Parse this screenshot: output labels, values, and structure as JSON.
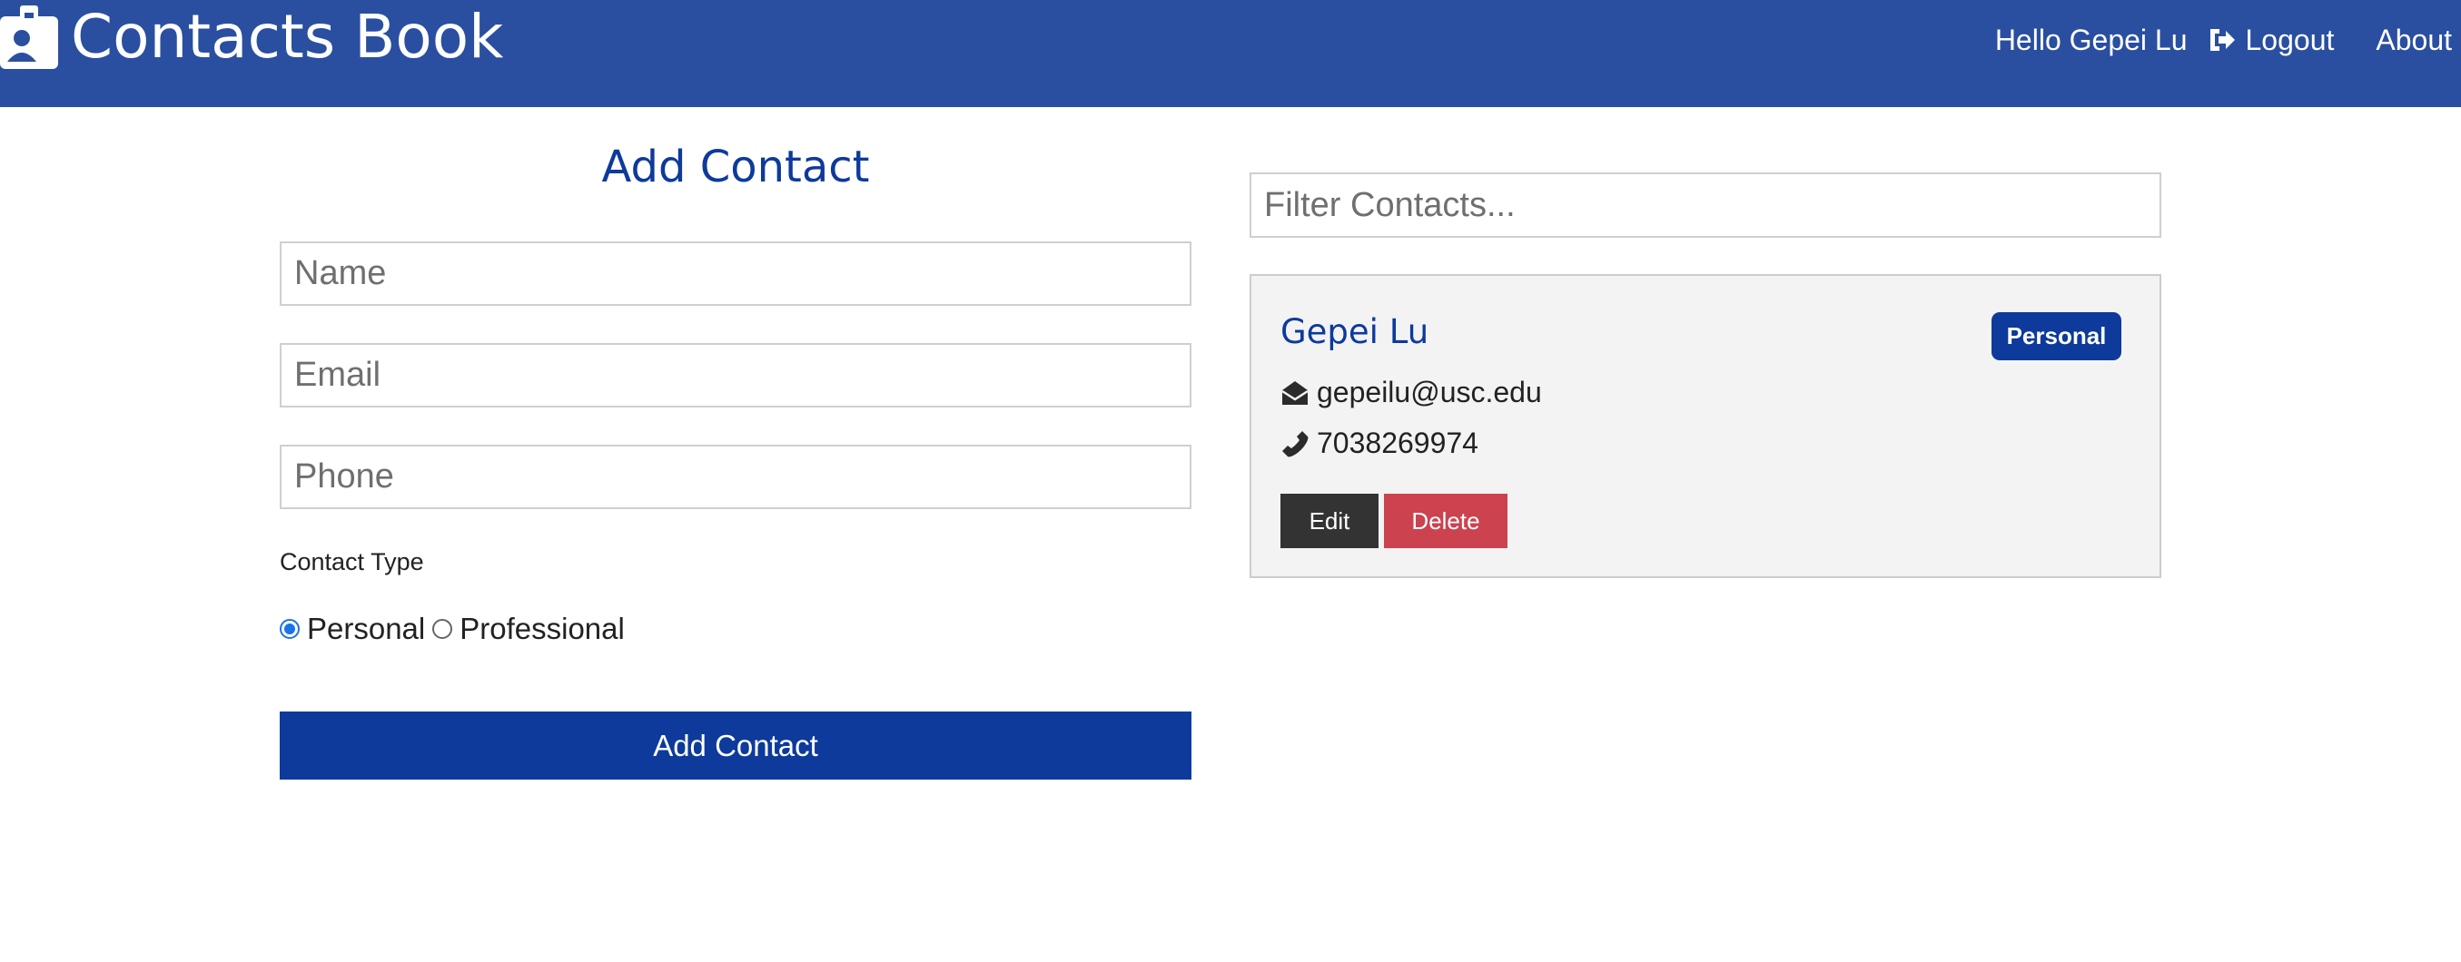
{
  "navbar": {
    "brand_icon": "contact-card-icon",
    "title": "Contacts Book",
    "greeting": "Hello Gepei Lu",
    "logout_icon": "sign-out-icon",
    "logout_label": "Logout",
    "about_label": "About",
    "background_color": "#2a4fa0"
  },
  "form": {
    "heading": "Add Contact",
    "name_placeholder": "Name",
    "email_placeholder": "Email",
    "phone_placeholder": "Phone",
    "type_label": "Contact Type",
    "options": [
      {
        "label": "Personal",
        "checked": true
      },
      {
        "label": "Professional",
        "checked": false
      }
    ],
    "submit_label": "Add Contact",
    "accent_color": "#0d3a9b"
  },
  "filter": {
    "placeholder": "Filter Contacts..."
  },
  "contacts": [
    {
      "name": "Gepei Lu",
      "type": "Personal",
      "email": "gepeilu@usc.edu",
      "phone": "7038269974",
      "email_icon": "envelope-open-icon",
      "phone_icon": "phone-icon",
      "edit_label": "Edit",
      "delete_label": "Delete",
      "delete_color": "#cc424f"
    }
  ]
}
